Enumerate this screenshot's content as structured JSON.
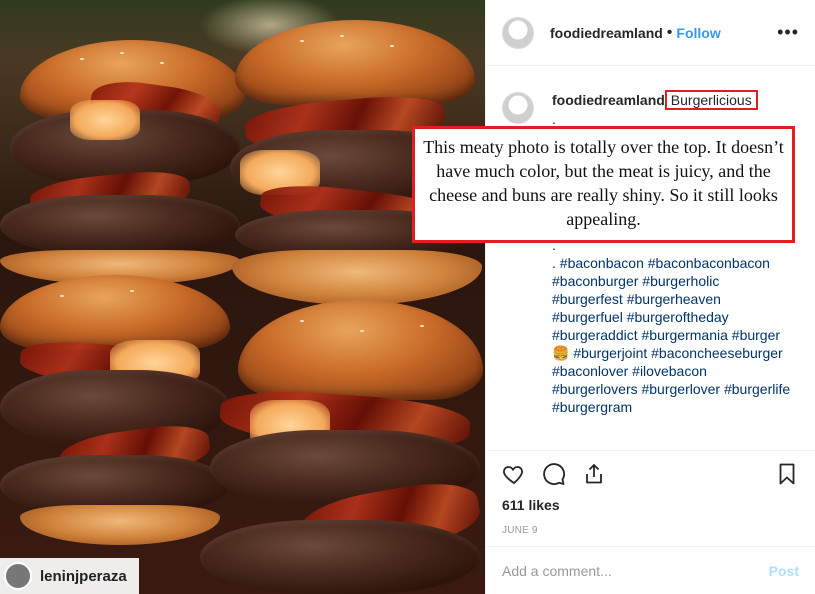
{
  "post": {
    "username": "foodiedreamland",
    "follow_label": "Follow",
    "separator": "•",
    "more_label": "•••"
  },
  "photo": {
    "tag_username": "leninjperaza"
  },
  "caption": {
    "username": "foodiedreamland",
    "title": "Burgerlicious",
    "dots": ".\n.\n.\n.\n.\n.\n.\n.",
    "hashtags": ". #baconbacon #baconbaconbacon #baconburger #burgerholic #burgerfest #burgerheaven #burgerfuel #burgeroftheday #burgeraddict #burgermania #burger🍔 #burgerjoint #baconcheeseburger #baconlover #ilovebacon #burgerlovers #burgerlover #burgerlife #burgergram"
  },
  "annotation": {
    "text": "This meaty photo is totally over the top. It doesn’t have much color, but the meat is juicy, and the cheese and buns are really shiny. So it still looks appealing."
  },
  "actions": {
    "icons": [
      "heart-icon",
      "comment-icon",
      "share-icon",
      "bookmark-icon"
    ],
    "likes": "611 likes",
    "date": "JUNE 9"
  },
  "comment_box": {
    "placeholder": "Add a comment...",
    "post_label": "Post"
  },
  "colors": {
    "accent": "#3897f0",
    "hashtag": "#003569",
    "annotation_border": "#e02020"
  }
}
